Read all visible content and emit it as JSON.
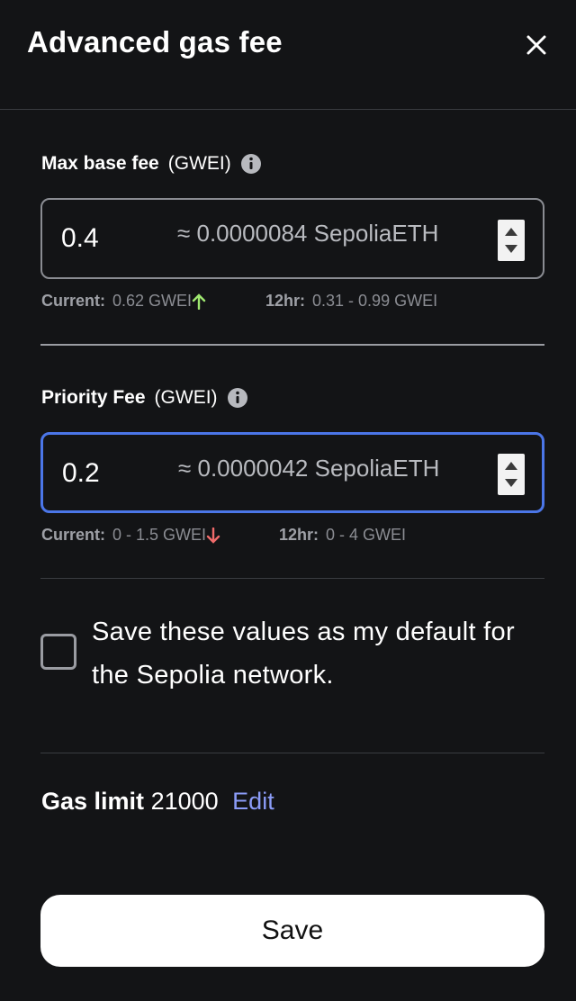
{
  "header": {
    "title": "Advanced gas fee",
    "close_icon": "close-icon"
  },
  "max_base_fee": {
    "label": "Max base fee",
    "unit": "(GWEI)",
    "value": "0.4",
    "approx": "≈ 0.0000084 SepoliaETH",
    "current_label": "Current:",
    "current_value": "0.62 GWEI",
    "trend": "up",
    "trend_color": "#9fe870",
    "range_label": "12hr:",
    "range_value": "0.31 - 0.99 GWEI"
  },
  "priority_fee": {
    "label": "Priority Fee",
    "unit": "(GWEI)",
    "value": "0.2",
    "approx": "≈ 0.0000042 SepoliaETH",
    "current_label": "Current:",
    "current_value": "0 - 1.5 GWEI",
    "trend": "down",
    "trend_color": "#f06b6b",
    "range_label": "12hr:",
    "range_value": "0 - 4 GWEI"
  },
  "default_checkbox": {
    "label": "Save these values as my default for the Sepolia network.",
    "checked": false
  },
  "gas_limit": {
    "label": "Gas limit",
    "value": "21000",
    "edit_label": "Edit"
  },
  "save_button": {
    "label": "Save"
  },
  "colors": {
    "background": "#131416",
    "focus_border": "#4b76e8",
    "link": "#8b9cf7"
  }
}
